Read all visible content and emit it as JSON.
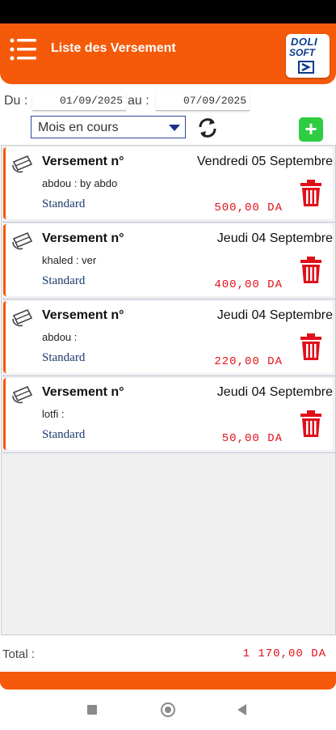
{
  "app": {
    "title": "Liste des Versement",
    "logo_line1": "DOLI",
    "logo_line2": "SOFT",
    "accent_color": "#f55a0a"
  },
  "filters": {
    "from_label": "Du :",
    "from_date": "01/09/2025",
    "to_label": "au :",
    "to_date": "07/09/2025",
    "period_selected": "Mois en cours"
  },
  "items": [
    {
      "title": "Versement n°",
      "date": "Vendredi 05 Septembre",
      "client": "abdou : by abdo",
      "type": "Standard",
      "amount": "500,00 DA"
    },
    {
      "title": "Versement n°",
      "date": "Jeudi 04 Septembre",
      "client": "khaled : ver",
      "type": "Standard",
      "amount": "400,00 DA"
    },
    {
      "title": "Versement n°",
      "date": "Jeudi 04 Septembre",
      "client": "abdou :",
      "type": "Standard",
      "amount": "220,00 DA"
    },
    {
      "title": "Versement n°",
      "date": "Jeudi 04 Septembre",
      "client": "lotfi :",
      "type": "Standard",
      "amount": "50,00 DA"
    }
  ],
  "footer": {
    "total_label": "Total :",
    "total_value": "1 170,00 DA"
  },
  "icons": {
    "menu": "menu-list-icon",
    "refresh": "refresh-icon",
    "add": "plus-icon",
    "item": "wallet-icon",
    "delete": "trash-icon"
  }
}
